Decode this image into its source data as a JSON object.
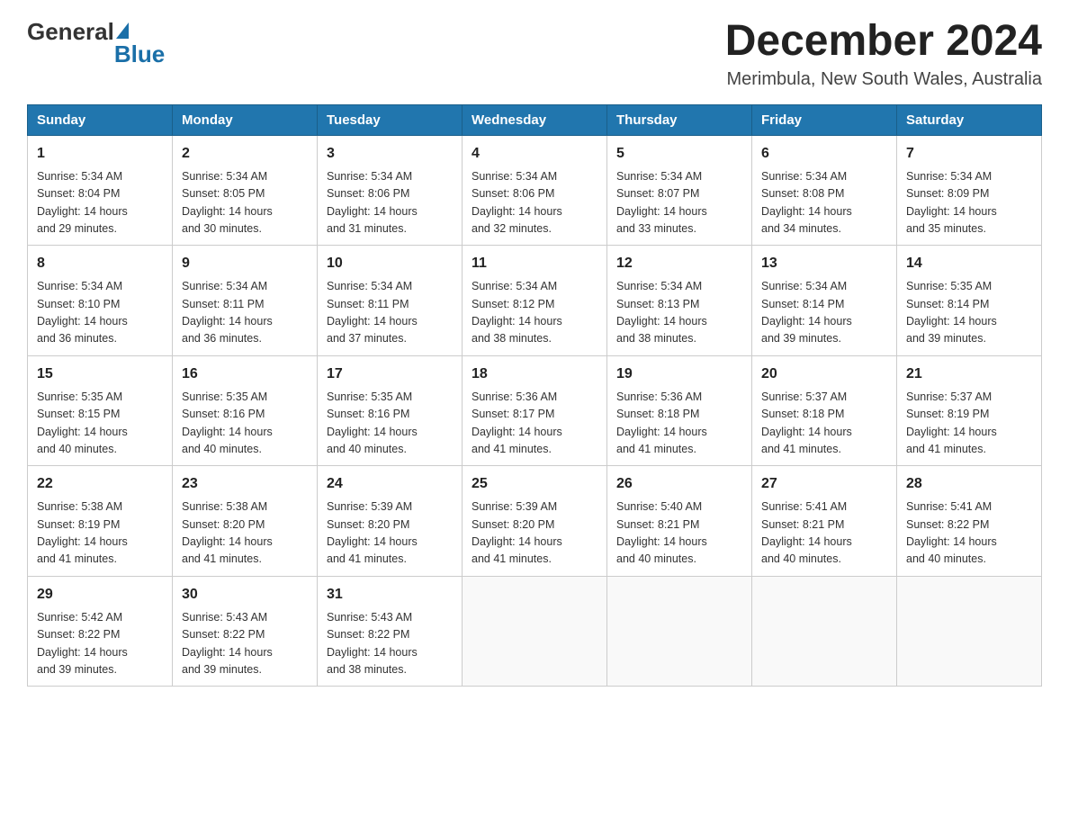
{
  "header": {
    "logo_general": "General",
    "logo_blue": "Blue",
    "month_title": "December 2024",
    "location": "Merimbula, New South Wales, Australia"
  },
  "weekdays": [
    "Sunday",
    "Monday",
    "Tuesday",
    "Wednesday",
    "Thursday",
    "Friday",
    "Saturday"
  ],
  "weeks": [
    [
      {
        "day": "1",
        "sunrise": "5:34 AM",
        "sunset": "8:04 PM",
        "daylight": "14 hours and 29 minutes."
      },
      {
        "day": "2",
        "sunrise": "5:34 AM",
        "sunset": "8:05 PM",
        "daylight": "14 hours and 30 minutes."
      },
      {
        "day": "3",
        "sunrise": "5:34 AM",
        "sunset": "8:06 PM",
        "daylight": "14 hours and 31 minutes."
      },
      {
        "day": "4",
        "sunrise": "5:34 AM",
        "sunset": "8:06 PM",
        "daylight": "14 hours and 32 minutes."
      },
      {
        "day": "5",
        "sunrise": "5:34 AM",
        "sunset": "8:07 PM",
        "daylight": "14 hours and 33 minutes."
      },
      {
        "day": "6",
        "sunrise": "5:34 AM",
        "sunset": "8:08 PM",
        "daylight": "14 hours and 34 minutes."
      },
      {
        "day": "7",
        "sunrise": "5:34 AM",
        "sunset": "8:09 PM",
        "daylight": "14 hours and 35 minutes."
      }
    ],
    [
      {
        "day": "8",
        "sunrise": "5:34 AM",
        "sunset": "8:10 PM",
        "daylight": "14 hours and 36 minutes."
      },
      {
        "day": "9",
        "sunrise": "5:34 AM",
        "sunset": "8:11 PM",
        "daylight": "14 hours and 36 minutes."
      },
      {
        "day": "10",
        "sunrise": "5:34 AM",
        "sunset": "8:11 PM",
        "daylight": "14 hours and 37 minutes."
      },
      {
        "day": "11",
        "sunrise": "5:34 AM",
        "sunset": "8:12 PM",
        "daylight": "14 hours and 38 minutes."
      },
      {
        "day": "12",
        "sunrise": "5:34 AM",
        "sunset": "8:13 PM",
        "daylight": "14 hours and 38 minutes."
      },
      {
        "day": "13",
        "sunrise": "5:34 AM",
        "sunset": "8:14 PM",
        "daylight": "14 hours and 39 minutes."
      },
      {
        "day": "14",
        "sunrise": "5:35 AM",
        "sunset": "8:14 PM",
        "daylight": "14 hours and 39 minutes."
      }
    ],
    [
      {
        "day": "15",
        "sunrise": "5:35 AM",
        "sunset": "8:15 PM",
        "daylight": "14 hours and 40 minutes."
      },
      {
        "day": "16",
        "sunrise": "5:35 AM",
        "sunset": "8:16 PM",
        "daylight": "14 hours and 40 minutes."
      },
      {
        "day": "17",
        "sunrise": "5:35 AM",
        "sunset": "8:16 PM",
        "daylight": "14 hours and 40 minutes."
      },
      {
        "day": "18",
        "sunrise": "5:36 AM",
        "sunset": "8:17 PM",
        "daylight": "14 hours and 41 minutes."
      },
      {
        "day": "19",
        "sunrise": "5:36 AM",
        "sunset": "8:18 PM",
        "daylight": "14 hours and 41 minutes."
      },
      {
        "day": "20",
        "sunrise": "5:37 AM",
        "sunset": "8:18 PM",
        "daylight": "14 hours and 41 minutes."
      },
      {
        "day": "21",
        "sunrise": "5:37 AM",
        "sunset": "8:19 PM",
        "daylight": "14 hours and 41 minutes."
      }
    ],
    [
      {
        "day": "22",
        "sunrise": "5:38 AM",
        "sunset": "8:19 PM",
        "daylight": "14 hours and 41 minutes."
      },
      {
        "day": "23",
        "sunrise": "5:38 AM",
        "sunset": "8:20 PM",
        "daylight": "14 hours and 41 minutes."
      },
      {
        "day": "24",
        "sunrise": "5:39 AM",
        "sunset": "8:20 PM",
        "daylight": "14 hours and 41 minutes."
      },
      {
        "day": "25",
        "sunrise": "5:39 AM",
        "sunset": "8:20 PM",
        "daylight": "14 hours and 41 minutes."
      },
      {
        "day": "26",
        "sunrise": "5:40 AM",
        "sunset": "8:21 PM",
        "daylight": "14 hours and 40 minutes."
      },
      {
        "day": "27",
        "sunrise": "5:41 AM",
        "sunset": "8:21 PM",
        "daylight": "14 hours and 40 minutes."
      },
      {
        "day": "28",
        "sunrise": "5:41 AM",
        "sunset": "8:22 PM",
        "daylight": "14 hours and 40 minutes."
      }
    ],
    [
      {
        "day": "29",
        "sunrise": "5:42 AM",
        "sunset": "8:22 PM",
        "daylight": "14 hours and 39 minutes."
      },
      {
        "day": "30",
        "sunrise": "5:43 AM",
        "sunset": "8:22 PM",
        "daylight": "14 hours and 39 minutes."
      },
      {
        "day": "31",
        "sunrise": "5:43 AM",
        "sunset": "8:22 PM",
        "daylight": "14 hours and 38 minutes."
      },
      null,
      null,
      null,
      null
    ]
  ],
  "labels": {
    "sunrise": "Sunrise:",
    "sunset": "Sunset:",
    "daylight": "Daylight:"
  }
}
